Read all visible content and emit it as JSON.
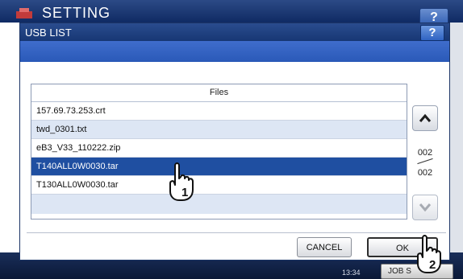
{
  "background": {
    "title": "SETTING",
    "help_label": "?",
    "time": "13:34",
    "job_label": "JOB S"
  },
  "dialog": {
    "title": "USB LIST",
    "help_label": "?",
    "files_header": "Files",
    "files": [
      {
        "name": "157.69.73.253.crt",
        "selected": false
      },
      {
        "name": "twd_0301.txt",
        "selected": false
      },
      {
        "name": "eB3_V33_110222.zip",
        "selected": false
      },
      {
        "name": "T140ALL0W0030.tar",
        "selected": true
      },
      {
        "name": "T130ALL0W0030.tar",
        "selected": false
      }
    ],
    "page_current": "002",
    "page_total": "002",
    "cancel_label": "CANCEL",
    "ok_label": "OK"
  },
  "callouts": {
    "step1": "1",
    "step2": "2"
  },
  "colors": {
    "titlebar": "#1f3f80",
    "band": "#3462c4",
    "selected_row": "#1f4fa1",
    "alt_row": "#dde6f4"
  }
}
